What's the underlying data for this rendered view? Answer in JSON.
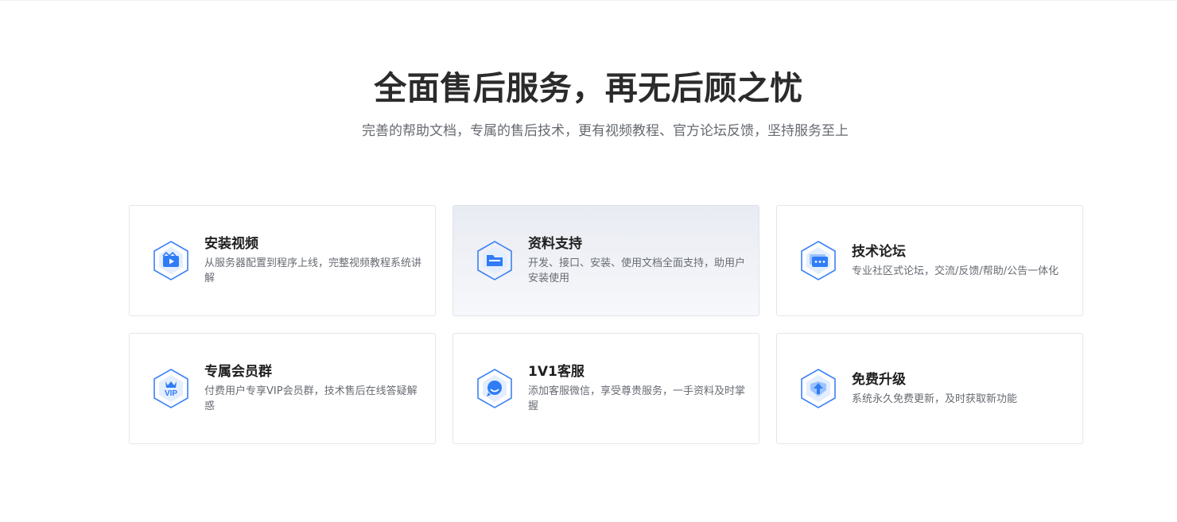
{
  "section": {
    "title": "全面售后服务，再无后顾之忧",
    "subtitle": "完善的帮助文档，专属的售后技术，更有视频教程、官方论坛反馈，坚持服务至上"
  },
  "cards": [
    {
      "title": "安装视频",
      "desc": "从服务器配置到程序上线，完整视频教程系统讲解",
      "icon": "video-icon"
    },
    {
      "title": "资料支持",
      "desc": "开发、接口、安装、使用文档全面支持，助用户安装使用",
      "icon": "folder-icon"
    },
    {
      "title": "技术论坛",
      "desc": "专业社区式论坛，交流/反馈/帮助/公告一体化",
      "icon": "chat-icon"
    },
    {
      "title": "专属会员群",
      "desc": "付费用户专享VIP会员群，技术售后在线答疑解惑",
      "icon": "vip-crown-icon"
    },
    {
      "title": "1V1客服",
      "desc": "添加客服微信，享受尊贵服务，一手资料及时掌握",
      "icon": "support-agent-icon"
    },
    {
      "title": "免费升级",
      "desc": "系统永久免费更新，及时获取新功能",
      "icon": "upgrade-arrow-icon"
    }
  ],
  "colors": {
    "accent": "#3b82f6",
    "icon_light": "#dbe9ff",
    "title": "#2b2b2b",
    "muted": "#666a70"
  }
}
